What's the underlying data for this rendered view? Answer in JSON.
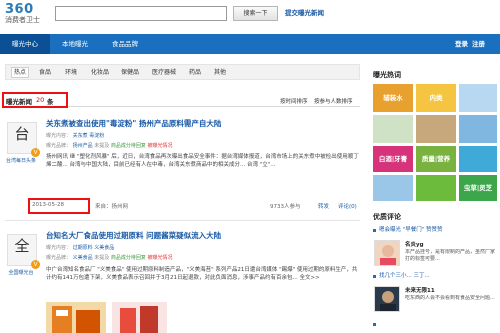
{
  "header": {
    "logo_num": "360",
    "logo_sub": "消费者卫士",
    "search_placeholder": "",
    "search_button": "搜索一下",
    "submit_link": "提交曝光新闻"
  },
  "nav": {
    "items": [
      "曝光中心",
      "本地曝光",
      "食品品牌"
    ],
    "login": "登录",
    "register": "注册"
  },
  "categories": [
    "热点",
    "食品",
    "环境",
    "化妆品",
    "保健品",
    "医疗器械",
    "药品",
    "其他"
  ],
  "section": {
    "title": "曝光新闻",
    "count": "20",
    "unit": "条",
    "sort_time": "按时间排序",
    "sort_follow": "按参与人数排序"
  },
  "articles": [
    {
      "logo_glyph": "台",
      "source": "台湾每日头条",
      "title": "关东煮被查出使用\"毒淀粉\" 扬州产品原料需产自大陆",
      "meta1_prefix": "曝光内容",
      "meta1_link": "关东煮",
      "meta1_tags": "毒淀粉",
      "meta2_prefix": "曝光品牌",
      "meta2_link": "扬州产品",
      "meta2_status": "未提及",
      "meta2_verify": "商品成分待回复",
      "meta2_gov": "被曝光情况",
      "body": "扬州网讯  继 \"塑化剂风暴\" 后，近日，台湾食品再次曝出食品安全事件：据台湾媒体报道，台湾市场上的关东煮中被检出使用顺丁烯二酸... 台湾与中国大陆，目前已经有人在中毒，台湾关东煮商品中的相关成分... 台湾 \"立\"...",
      "date": "2013-05-28",
      "from": "来自：扬州网",
      "views": "9733人参与",
      "share": "转发",
      "comment": "评论(0)"
    },
    {
      "logo_glyph": "全",
      "source": "全国曝光台",
      "title": "台知名大厂食品使用过期原料  问题酱菜疑似流入大陆",
      "meta1_prefix": "曝光内容",
      "meta1_link": "过期原料",
      "meta1_tags": "义美食品",
      "meta2_prefix": "曝光品牌",
      "meta2_link": "义美食品",
      "meta2_status": "未提及",
      "meta2_verify": "商品成分待回复",
      "meta2_gov": "被曝光情况",
      "body": "中广台湾知名食品厂 \"义美食品\" 使用过期原料制造产品，\"义美海苔\" 系列产品21日遭台湾媒体 \"踢爆\" 使用过期的原料生产，共计约有141万包遭下架，义美食品表示召回并于3月21日起退款，对此负面消息，涉事产品约有百余包... 全文>>"
    }
  ],
  "sidebar": {
    "hot_title": "曝光热词",
    "tiles": [
      {
        "label": "辅装水",
        "color": "#e8a12e"
      },
      {
        "label": "内类",
        "color": "#f5c542"
      },
      {
        "label": "白酒|牙膏",
        "color": "#d6337a"
      },
      {
        "label": "质量|营养",
        "color": "#7ab23f"
      },
      {
        "label": "",
        "color": "#9ac6e8"
      },
      {
        "label": "",
        "color": "#6dbb3c"
      },
      {
        "label": "",
        "color": "#e8a12e"
      },
      {
        "label": "虫草|灵芝",
        "color": "#3ea64a"
      }
    ],
    "review_title": "优质评论",
    "reviews": [
      {
        "head": "嗯会曝光 \"早餐门\" 赞赞赞",
        "name": "名炎yg",
        "text": "本产品挂号，是有限制的产品，虽然厂家打的标签可要..."
      },
      {
        "head": "找几个三小... 三丁...",
        "name": "未来无限11",
        "text": "吃东西的人会不会看到有食品安全问题..."
      }
    ]
  }
}
